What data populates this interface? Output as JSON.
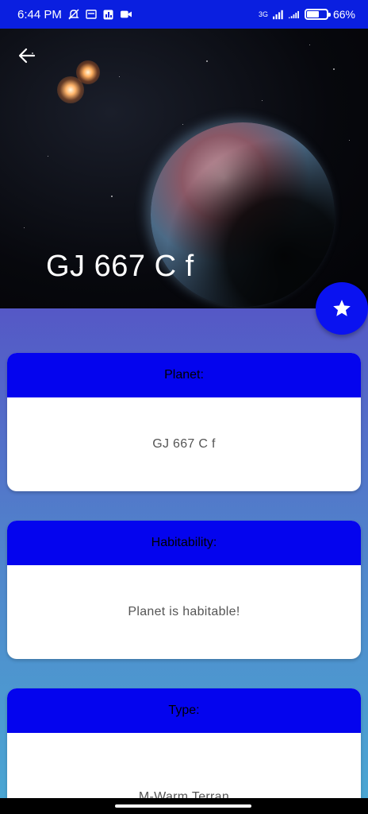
{
  "status_bar": {
    "time": "6:44 PM",
    "network": "3G",
    "battery_percent": "66%",
    "battery_level": 0.66
  },
  "hero": {
    "title": "GJ 667 C f"
  },
  "cards": [
    {
      "header": "Planet:",
      "value": "GJ 667 C f"
    },
    {
      "header": "Habitability:",
      "value": "Planet is habitable!"
    },
    {
      "header": "Type:",
      "value": "M-Warm Terran"
    }
  ],
  "colors": {
    "status_bar": "#0a1fe0",
    "accent": "#0404ee",
    "fab": "#0a12f0"
  },
  "icons": {
    "back": "arrow-left-icon",
    "favorite": "star-icon"
  }
}
